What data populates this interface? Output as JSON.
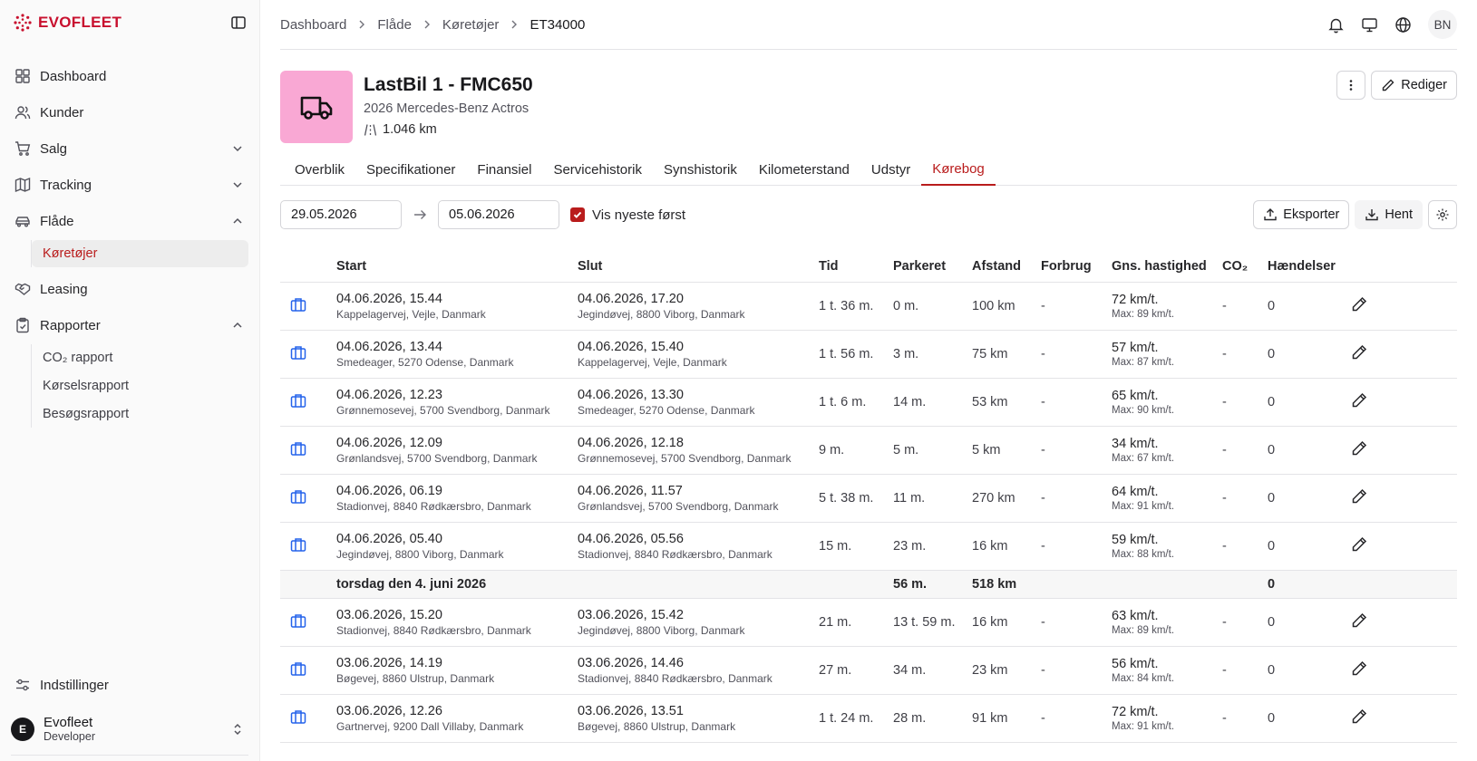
{
  "brand": {
    "name": "EVOFLEET"
  },
  "sidebar": {
    "items": [
      {
        "label": "Dashboard",
        "icon": "grid-icon"
      },
      {
        "label": "Kunder",
        "icon": "users-icon"
      },
      {
        "label": "Salg",
        "icon": "cart-icon"
      },
      {
        "label": "Tracking",
        "icon": "map-icon"
      },
      {
        "label": "Flåde",
        "icon": "car-icon"
      },
      {
        "label": "Leasing",
        "icon": "handshake-icon"
      },
      {
        "label": "Rapporter",
        "icon": "clipboard-icon"
      }
    ],
    "flade_sub": [
      {
        "label": "Køretøjer"
      }
    ],
    "rapporter_sub": [
      {
        "label": "CO₂ rapport"
      },
      {
        "label": "Kørselsrapport"
      },
      {
        "label": "Besøgsrapport"
      }
    ],
    "settings_label": "Indstillinger",
    "user": {
      "initial": "E",
      "name": "Evofleet",
      "role": "Developer"
    }
  },
  "breadcrumb": [
    "Dashboard",
    "Flåde",
    "Køretøjer",
    "ET34000"
  ],
  "header_user_initials": "BN",
  "vehicle": {
    "title": "LastBil 1 - FMC650",
    "subtitle": "2026 Mercedes-Benz Actros",
    "km": "1.046 km"
  },
  "actions": {
    "edit_label": "Rediger"
  },
  "tabs": [
    "Overblik",
    "Specifikationer",
    "Finansiel",
    "Servicehistorik",
    "Synshistorik",
    "Kilometerstand",
    "Udstyr",
    "Kørebog"
  ],
  "active_tab": "Kørebog",
  "filters": {
    "from": "29.05.2026",
    "to": "05.06.2026",
    "newest_first_label": "Vis nyeste først",
    "newest_first": true,
    "export_label": "Eksporter",
    "fetch_label": "Hent"
  },
  "table": {
    "columns": [
      "Start",
      "Slut",
      "Tid",
      "Parkeret",
      "Afstand",
      "Forbrug",
      "Gns. hastighed",
      "CO₂",
      "Hændelser"
    ],
    "rows_a": [
      {
        "start": "04.06.2026, 15.44",
        "start_addr": "Kappelagervej, Vejle, Danmark",
        "end": "04.06.2026, 17.20",
        "end_addr": "Jegindøvej, 8800 Viborg, Danmark",
        "tid": "1 t. 36 m.",
        "parkeret": "0 m.",
        "afstand": "100 km",
        "forbrug": "-",
        "speed": "72 km/t.",
        "max": "Max: 89 km/t.",
        "co2": "-",
        "events": "0"
      },
      {
        "start": "04.06.2026, 13.44",
        "start_addr": "Smedeager, 5270 Odense, Danmark",
        "end": "04.06.2026, 15.40",
        "end_addr": "Kappelagervej, Vejle, Danmark",
        "tid": "1 t. 56 m.",
        "parkeret": "3 m.",
        "afstand": "75 km",
        "forbrug": "-",
        "speed": "57 km/t.",
        "max": "Max: 87 km/t.",
        "co2": "-",
        "events": "0"
      },
      {
        "start": "04.06.2026, 12.23",
        "start_addr": "Grønnemosevej, 5700 Svendborg, Danmark",
        "end": "04.06.2026, 13.30",
        "end_addr": "Smedeager, 5270 Odense, Danmark",
        "tid": "1 t. 6 m.",
        "parkeret": "14 m.",
        "afstand": "53 km",
        "forbrug": "-",
        "speed": "65 km/t.",
        "max": "Max: 90 km/t.",
        "co2": "-",
        "events": "0"
      },
      {
        "start": "04.06.2026, 12.09",
        "start_addr": "Grønlandsvej, 5700 Svendborg, Danmark",
        "end": "04.06.2026, 12.18",
        "end_addr": "Grønnemosevej, 5700 Svendborg, Danmark",
        "tid": "9 m.",
        "parkeret": "5 m.",
        "afstand": "5 km",
        "forbrug": "-",
        "speed": "34 km/t.",
        "max": "Max: 67 km/t.",
        "co2": "-",
        "events": "0"
      },
      {
        "start": "04.06.2026, 06.19",
        "start_addr": "Stadionvej, 8840 Rødkærsbro, Danmark",
        "end": "04.06.2026, 11.57",
        "end_addr": "Grønlandsvej, 5700 Svendborg, Danmark",
        "tid": "5 t. 38 m.",
        "parkeret": "11 m.",
        "afstand": "270 km",
        "forbrug": "-",
        "speed": "64 km/t.",
        "max": "Max: 91 km/t.",
        "co2": "-",
        "events": "0"
      },
      {
        "start": "04.06.2026, 05.40",
        "start_addr": "Jegindøvej, 8800 Viborg, Danmark",
        "end": "04.06.2026, 05.56",
        "end_addr": "Stadionvej, 8840 Rødkærsbro, Danmark",
        "tid": "15 m.",
        "parkeret": "23 m.",
        "afstand": "16 km",
        "forbrug": "-",
        "speed": "59 km/t.",
        "max": "Max: 88 km/t.",
        "co2": "-",
        "events": "0"
      }
    ],
    "summary": {
      "label": "torsdag den 4. juni 2026",
      "parkeret": "56 m.",
      "afstand": "518 km",
      "events": "0"
    },
    "rows_b": [
      {
        "start": "03.06.2026, 15.20",
        "start_addr": "Stadionvej, 8840 Rødkærsbro, Danmark",
        "end": "03.06.2026, 15.42",
        "end_addr": "Jegindøvej, 8800 Viborg, Danmark",
        "tid": "21 m.",
        "parkeret": "13 t. 59 m.",
        "afstand": "16 km",
        "forbrug": "-",
        "speed": "63 km/t.",
        "max": "Max: 89 km/t.",
        "co2": "-",
        "events": "0"
      },
      {
        "start": "03.06.2026, 14.19",
        "start_addr": "Bøgevej, 8860 Ulstrup, Danmark",
        "end": "03.06.2026, 14.46",
        "end_addr": "Stadionvej, 8840 Rødkærsbro, Danmark",
        "tid": "27 m.",
        "parkeret": "34 m.",
        "afstand": "23 km",
        "forbrug": "-",
        "speed": "56 km/t.",
        "max": "Max: 84 km/t.",
        "co2": "-",
        "events": "0"
      },
      {
        "start": "03.06.2026, 12.26",
        "start_addr": "Gartnervej, 9200 Dall Villaby, Danmark",
        "end": "03.06.2026, 13.51",
        "end_addr": "Bøgevej, 8860 Ulstrup, Danmark",
        "tid": "1 t. 24 m.",
        "parkeret": "28 m.",
        "afstand": "91 km",
        "forbrug": "-",
        "speed": "72 km/t.",
        "max": "Max: 91 km/t.",
        "co2": "-",
        "events": "0"
      }
    ]
  },
  "colors": {
    "accent": "#b91c1c",
    "brand": "#c8102e",
    "vehicle_bg": "#f9a8d4",
    "trip_icon": "#2563eb"
  }
}
